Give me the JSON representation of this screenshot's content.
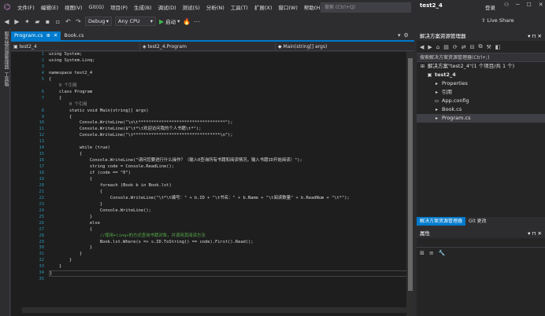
{
  "menu": {
    "items": [
      "文件(F)",
      "编辑(E)",
      "视图(V)",
      "Git(G)",
      "项目(P)",
      "生成(B)",
      "调试(D)",
      "测试(S)",
      "分析(N)",
      "工具(T)",
      "扩展(X)",
      "窗口(W)",
      "帮助(H)"
    ],
    "search_placeholder": "搜索 (Ctrl+Q)",
    "solution_name": "test2_4",
    "login": "登录"
  },
  "toolbar": {
    "config": "Debug",
    "platform": "Any CPU",
    "run_label": "启动",
    "liveshare": "Live Share"
  },
  "left_strip": {
    "tab1": "服务器资源管理器",
    "tab2": "工具箱"
  },
  "editor": {
    "tabs": [
      {
        "label": "Program.cs",
        "active": true
      },
      {
        "label": "Book.cs",
        "active": false
      }
    ],
    "nav": {
      "project": "test2_4",
      "class": "test2_4.Program",
      "member": "Main(string[] args)"
    },
    "lines": [
      {
        "n": "1",
        "text": "using System;",
        "kind": "code"
      },
      {
        "n": "2",
        "text": "using System.Linq;",
        "kind": "code"
      },
      {
        "n": "3",
        "text": "",
        "kind": "code"
      },
      {
        "n": "4",
        "text": "namespace test2_4",
        "kind": "code"
      },
      {
        "n": "5",
        "text": "{",
        "kind": "code"
      },
      {
        "n": "",
        "text": "    0 个引用",
        "kind": "hint"
      },
      {
        "n": "6",
        "text": "    class Program",
        "kind": "code"
      },
      {
        "n": "7",
        "text": "    {",
        "kind": "code"
      },
      {
        "n": "",
        "text": "        0 个引用",
        "kind": "hint"
      },
      {
        "n": "8",
        "text": "        static void Main(string[] args)",
        "kind": "code"
      },
      {
        "n": "9",
        "text": "        {",
        "kind": "code"
      },
      {
        "n": "10",
        "text": "            Console.WriteLine(\"\\n\\t**********************************\");",
        "kind": "code"
      },
      {
        "n": "11",
        "text": "            Console.WriteLine($\"\\t*\\t欢迎访问我的个人书籍\\t*\");",
        "kind": "code"
      },
      {
        "n": "12",
        "text": "            Console.WriteLine(\"\\t**********************************\\n\");",
        "kind": "code"
      },
      {
        "n": "13",
        "text": "",
        "kind": "code"
      },
      {
        "n": "14",
        "text": "            while (true)",
        "kind": "code"
      },
      {
        "n": "15",
        "text": "            {",
        "kind": "code"
      },
      {
        "n": "16",
        "text": "                Console.WriteLine(\"请问您要进行什么操作？（输入0查询所有书籍和阅读情况，输入书籍ID开始阅读）\");",
        "kind": "code"
      },
      {
        "n": "17",
        "text": "                string code = Console.ReadLine();",
        "kind": "code"
      },
      {
        "n": "18",
        "text": "                if (code == \"0\")",
        "kind": "code"
      },
      {
        "n": "19",
        "text": "                {",
        "kind": "code"
      },
      {
        "n": "20",
        "text": "                    foreach (Book b in Book.lst)",
        "kind": "code"
      },
      {
        "n": "21",
        "text": "                    {",
        "kind": "code"
      },
      {
        "n": "22",
        "text": "                        Console.WriteLine(\"\\t*\\t编号：\" + b.ID + \"\\t书名：\" + b.Name + \"\\t阅读数量\" + b.ReadNum + \"\\t*\");",
        "kind": "code"
      },
      {
        "n": "23",
        "text": "                    }",
        "kind": "code"
      },
      {
        "n": "24",
        "text": "                    Console.WriteLine();",
        "kind": "code"
      },
      {
        "n": "25",
        "text": "                }",
        "kind": "code"
      },
      {
        "n": "26",
        "text": "                else",
        "kind": "code"
      },
      {
        "n": "27",
        "text": "                {",
        "kind": "code"
      },
      {
        "n": "28",
        "text": "                    //使用+linq+的方式查询书籍对象，并调用其阅读方法",
        "kind": "cmt"
      },
      {
        "n": "29",
        "text": "                    Book.lst.Where(s => s.ID.ToString() == code).First().Read();",
        "kind": "code"
      },
      {
        "n": "30",
        "text": "                }",
        "kind": "code"
      },
      {
        "n": "31",
        "text": "            }",
        "kind": "code"
      },
      {
        "n": "32",
        "text": "        }",
        "kind": "code"
      },
      {
        "n": "33",
        "text": "    }",
        "kind": "code"
      },
      {
        "n": "34",
        "text": "}",
        "kind": "cur"
      },
      {
        "n": "35",
        "text": "",
        "kind": "code"
      }
    ]
  },
  "solution_explorer": {
    "title": "解决方案资源管理器",
    "search_placeholder": "搜索解决方案资源管理器(Ctrl+;)",
    "tree": [
      {
        "label": "解决方案\"test2_4\"(1 个项目/共 1 个)",
        "icon": "⊞",
        "indent": 0
      },
      {
        "label": "test2_4",
        "icon": "▣",
        "indent": 1,
        "bold": true
      },
      {
        "label": "Properties",
        "icon": "▸",
        "indent": 2
      },
      {
        "label": "引用",
        "icon": "▸",
        "indent": 2
      },
      {
        "label": "App.config",
        "icon": "▭",
        "indent": 2
      },
      {
        "label": "Book.cs",
        "icon": "▸",
        "indent": 2
      },
      {
        "label": "Program.cs",
        "icon": "▸",
        "indent": 2,
        "selected": true
      }
    ],
    "tabs": [
      "解决方案资源管理器",
      "Git 更改"
    ]
  },
  "properties": {
    "title": "属性"
  }
}
